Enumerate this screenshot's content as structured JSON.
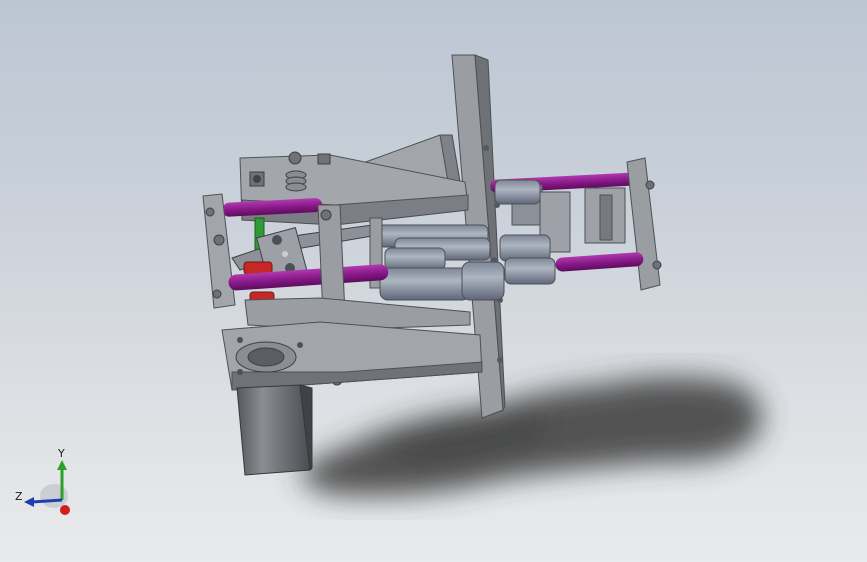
{
  "viewport": {
    "background_top": "#bcc6d3",
    "background_bottom": "#e9eaeb"
  },
  "model": {
    "part_color": "#8d9096",
    "part_dark": "#5f6267",
    "rod_color_purple": "#8a1a8a",
    "rod_color_green": "#2f9a36",
    "bumper_color": "#c62828",
    "shadow_color": "#3a3a3a"
  },
  "triad": {
    "y_label": "Y",
    "z_label": "Z",
    "y_color": "#2ca02c",
    "z_color": "#1f3fae",
    "x_color": "#d21e1e"
  }
}
